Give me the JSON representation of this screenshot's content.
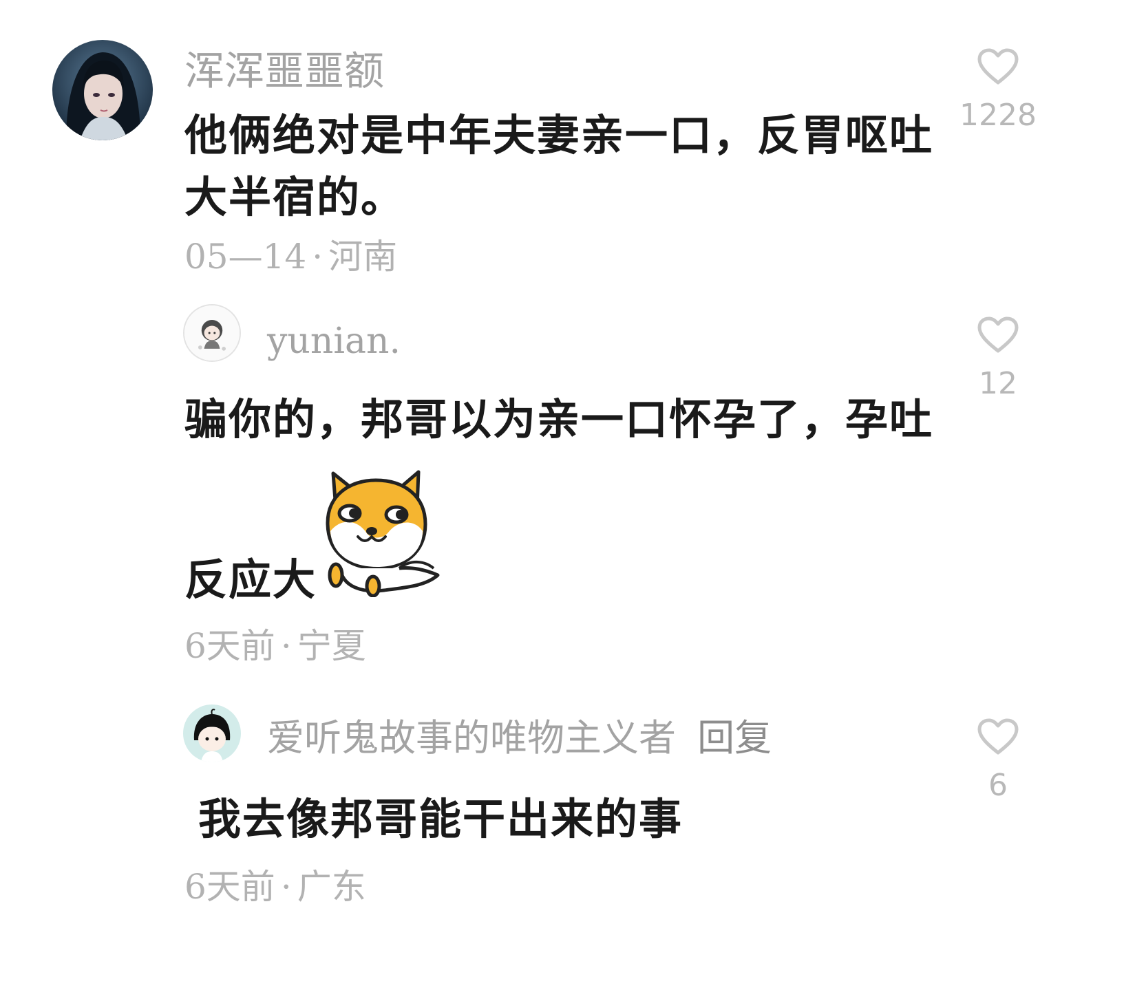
{
  "comments": [
    {
      "username": "浑浑噩噩额",
      "text": "他俩绝对是中年夫妻亲一口，反胃呕吐大半宿的。",
      "time": "05—14",
      "separator": "·",
      "location": "河南",
      "likes": "1228",
      "avatar_icon": "anime-girl-avatar"
    },
    {
      "username": "yunian.",
      "text_line1": "骗你的，邦哥以为亲一口怀孕了，孕吐",
      "text_line2": "反应大",
      "time": "6天前",
      "separator": "·",
      "location": "宁夏",
      "likes": "12",
      "avatar_icon": "cartoon-child-avatar",
      "sticker_icon": "shiba-dog-sticker"
    },
    {
      "username": "爱听鬼故事的唯物主义者",
      "reply_label": "回复",
      "text": "我去像邦哥能干出来的事",
      "time": "6天前",
      "separator": "·",
      "location": "广东",
      "likes": "6",
      "avatar_icon": "cartoon-boy-avatar"
    }
  ],
  "colors": {
    "username": "#a3a3a3",
    "body_text": "#1a1a1a",
    "meta_text": "#b2b2b2",
    "heart": "#c8c8c8",
    "sticker_orange": "#f5b530"
  }
}
